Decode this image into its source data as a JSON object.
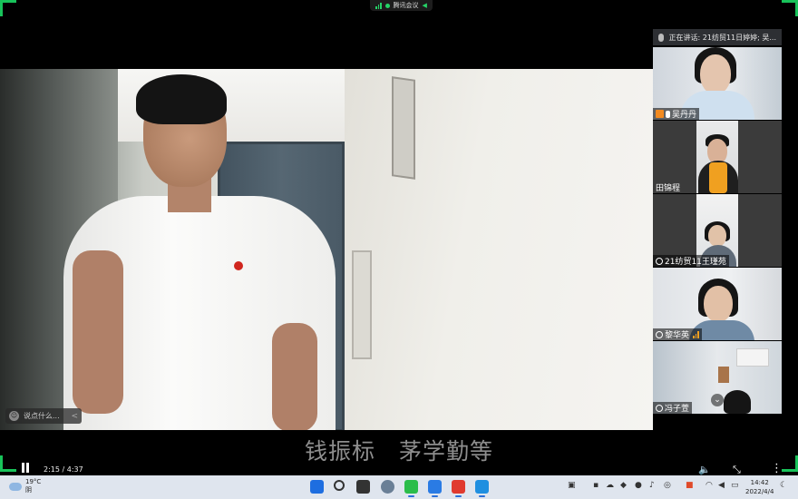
{
  "meeting": {
    "app_title": "腾讯会议",
    "speaking_label": "正在讲话: 21纺贸11日婷婷; 吴..."
  },
  "video": {
    "subtitle": "钱振标　茅学勤等",
    "elapsed": "2:15",
    "duration": "4:37",
    "time_display": "2:15 / 4:37",
    "chat_placeholder": "说点什么...",
    "chat_collapse": "<"
  },
  "participants": [
    {
      "name": "吴丹丹",
      "host": true,
      "mic": true,
      "speaking": false
    },
    {
      "name": "田锦程",
      "host": false,
      "mic": false,
      "speaking": false
    },
    {
      "name": "21纺贸11王瑾苑",
      "host": false,
      "mic": true,
      "speaking": false
    },
    {
      "name": "黎华英",
      "host": false,
      "mic": true,
      "speaking": true
    },
    {
      "name": "冯子萱",
      "host": false,
      "mic": true,
      "speaking": false
    }
  ],
  "taskbar": {
    "weather_temp": "19°C",
    "weather_desc": "阴",
    "clock_time": "14:42",
    "clock_date": "2022/4/4",
    "pinned_icons": [
      "windows-start-icon",
      "search-icon",
      "task-view-icon",
      "settings-icon",
      "wechat-icon",
      "tencent-meeting-icon",
      "wps-icon",
      "media-player-icon"
    ]
  },
  "colors": {
    "accent_green": "#18c35a",
    "host_orange": "#f28a20",
    "taskbar_bg": "#dfe5ee"
  }
}
